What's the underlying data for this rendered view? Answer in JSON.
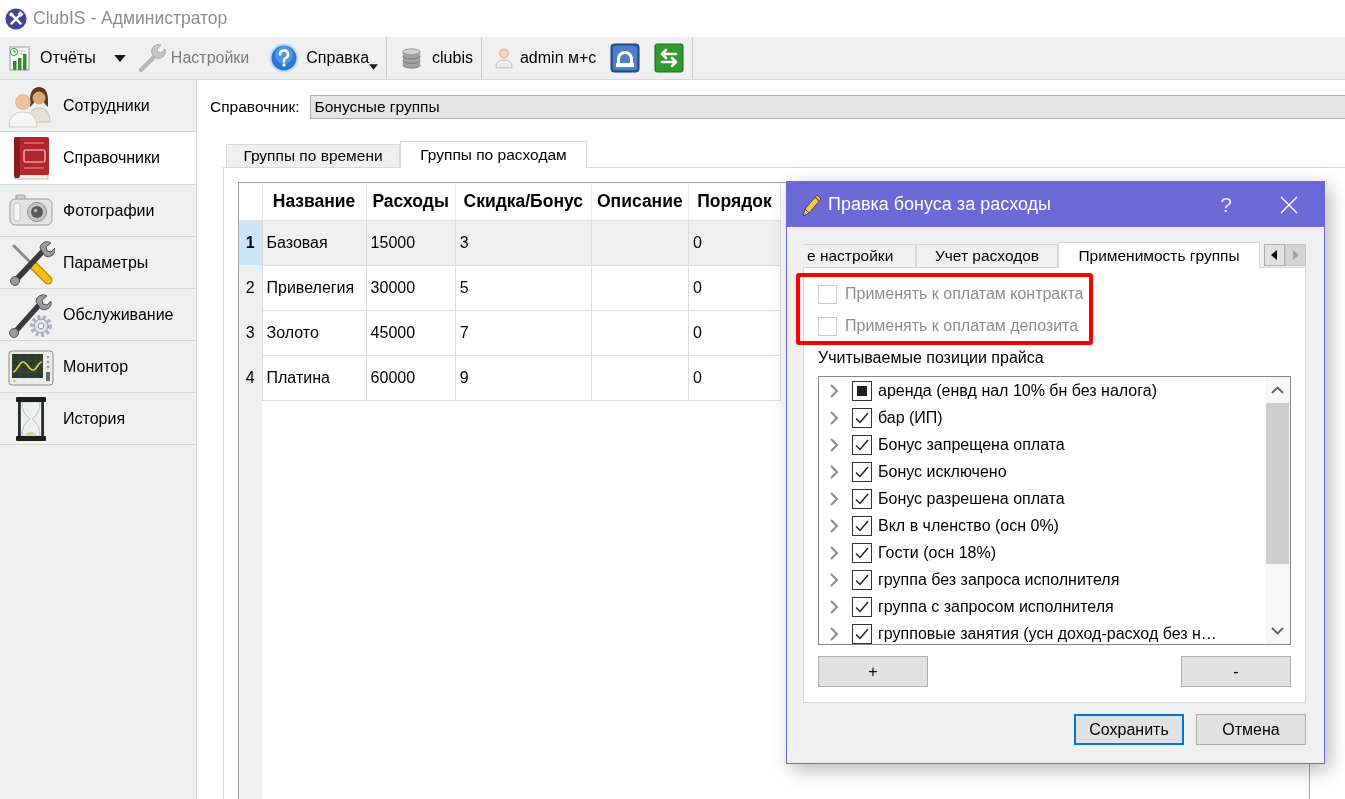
{
  "window": {
    "title": "ClubIS - Администратор"
  },
  "toolbar": {
    "groups": [
      {
        "items": [
          {
            "kind": "split",
            "label": "Отчёты",
            "disabled": false
          },
          {
            "kind": "plain",
            "label": "Настройки",
            "disabled": true
          },
          {
            "kind": "menu",
            "label": "Справка",
            "disabled": false
          }
        ]
      },
      {
        "items": [
          {
            "kind": "plain",
            "label": "clubis",
            "disabled": false
          }
        ]
      },
      {
        "items": [
          {
            "kind": "plain",
            "label": "admin м+с",
            "disabled": false
          },
          {
            "kind": "icon",
            "disabled": false
          },
          {
            "kind": "icon",
            "disabled": false
          }
        ]
      }
    ]
  },
  "sidebar": {
    "items": [
      {
        "label": "Сотрудники",
        "selected": false
      },
      {
        "label": "Справочники",
        "selected": true
      },
      {
        "label": "Фотографии",
        "selected": false
      },
      {
        "label": "Параметры",
        "selected": false
      },
      {
        "label": "Обслуживание",
        "selected": false
      },
      {
        "label": "Монитор",
        "selected": false
      },
      {
        "label": "История",
        "selected": false
      }
    ]
  },
  "catalog": {
    "label": "Справочник:",
    "value": "Бонусные группы"
  },
  "tabs": [
    {
      "label": "Группы по времени",
      "selected": false
    },
    {
      "label": "Группы по расходам",
      "selected": true
    }
  ],
  "table": {
    "columns": [
      "Название",
      "Расходы",
      "Скидка/Бонус",
      "Описание",
      "Порядок"
    ],
    "rows": [
      {
        "number": "1",
        "selected": true,
        "name": "Базовая",
        "expenses": "15000",
        "discount": "3",
        "order": "0"
      },
      {
        "number": "2",
        "selected": false,
        "name": "Привелегия",
        "expenses": "30000",
        "discount": "5",
        "order": "0"
      },
      {
        "number": "3",
        "selected": false,
        "name": "Золото",
        "expenses": "45000",
        "discount": "7",
        "order": "0"
      },
      {
        "number": "4",
        "selected": false,
        "name": "Платина",
        "expenses": "60000",
        "discount": "9",
        "order": "0"
      }
    ]
  },
  "dialog": {
    "title": "Правка бонуса за расходы",
    "help": "?",
    "tabs": [
      {
        "label": "е настройки",
        "selected": false
      },
      {
        "label": "Учет расходов",
        "selected": false
      },
      {
        "label": "Применимость группы",
        "selected": true
      }
    ],
    "options_highlighted": true,
    "options": [
      {
        "label": "Применять к оплатам контракта",
        "checked": false,
        "disabled": true
      },
      {
        "label": "Применять к оплатам депозита",
        "checked": false,
        "disabled": true
      }
    ],
    "price_list": {
      "label": "Учитываемые позиции прайса",
      "items": [
        {
          "label": "аренда (енвд нал 10% бн без налога)",
          "checked": true,
          "partial": true,
          "expanded": false
        },
        {
          "label": "бар (ИП)",
          "checked": true,
          "partial": false,
          "expanded": false
        },
        {
          "label": "Бонус запрещена оплата",
          "checked": true,
          "partial": false,
          "expanded": false
        },
        {
          "label": "Бонус исключено",
          "checked": true,
          "partial": false,
          "expanded": false
        },
        {
          "label": "Бонус разрешена оплата",
          "checked": true,
          "partial": false,
          "expanded": false
        },
        {
          "label": "Вкл в членство (осн 0%)",
          "checked": true,
          "partial": false,
          "expanded": false
        },
        {
          "label": "Гости (осн 18%)",
          "checked": true,
          "partial": false,
          "expanded": false
        },
        {
          "label": "группа без запроса исполнителя",
          "checked": true,
          "partial": false,
          "expanded": false
        },
        {
          "label": "группа с запросом исполнителя",
          "checked": true,
          "partial": false,
          "expanded": false
        },
        {
          "label": "групповые занятия (усн доход-расход без н…",
          "checked": true,
          "partial": false,
          "expanded": false
        }
      ]
    },
    "list_buttons": [
      "+",
      "-"
    ],
    "buttons": [
      {
        "label": "Сохранить",
        "default": true
      },
      {
        "label": "Отмена",
        "default": false
      }
    ]
  }
}
